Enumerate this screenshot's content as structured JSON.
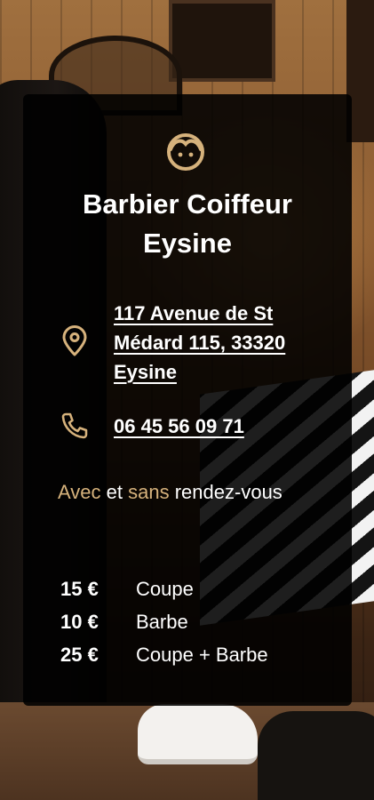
{
  "business": {
    "title_line1": "Barbier Coiffeur",
    "title_line2": "Eysine",
    "logo_icon": "barber-face-icon"
  },
  "contact": {
    "address_line1": "117 Avenue de St",
    "address_line2": "Médard 115, 33320",
    "address_line3": "Eysine",
    "address_icon": "map-pin-icon",
    "phone": "06 45 56 09 71",
    "phone_icon": "phone-icon"
  },
  "hours": {
    "word1": "Avec",
    "word2": "et",
    "word3": "sans",
    "word4": "rendez-vous"
  },
  "prices": [
    {
      "amount": "15 €",
      "label": "Coupe"
    },
    {
      "amount": "10 €",
      "label": "Barbe"
    },
    {
      "amount": "25 €",
      "label": "Coupe + Barbe"
    }
  ],
  "colors": {
    "accent_gold": "#d6b27c",
    "text": "#ffffff",
    "card_background": "rgba(0,0,0,0.88)"
  }
}
